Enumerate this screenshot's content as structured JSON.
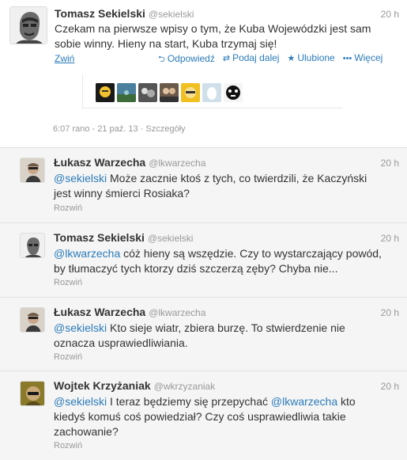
{
  "main_tweet": {
    "name": "Tomasz Sekielski",
    "handle": "@sekielski",
    "time": "20 h",
    "text_line1": "Czekam na pierwsze wpisy o tym, że Kuba Wojewódzki jest sam",
    "text_line2": "sobie winny. Hieny na start, Kuba trzymaj się!",
    "collapse_label": "Zwiń",
    "actions": {
      "reply": "Odpowiedź",
      "retweet": "Podaj dalej",
      "favorite": "Ulubione",
      "more": "Więcej"
    },
    "meta": "6:07 rano - 21 paź. 13 · Szczegóły"
  },
  "replies": [
    {
      "name": "Łukasz Warzecha",
      "handle": "@lkwarzecha",
      "time": "20 h",
      "mention": "@sekielski",
      "text_a": " Może zacznie ktoś z tych, co twierdzili, że Kaczyński",
      "text_b": "jest winny śmierci Rosiaka?",
      "expand": "Rozwiń"
    },
    {
      "name": "Tomasz Sekielski",
      "handle": "@sekielski",
      "time": "20 h",
      "mention": "@lkwarzecha",
      "text_a": " cóż hieny są wszędzie. Czy to wystarczający powód,",
      "text_b": "by tłumaczyć tych ktorzy dziś szczerzą zęby? Chyba nie...",
      "expand": "Rozwiń"
    },
    {
      "name": "Łukasz Warzecha",
      "handle": "@lkwarzecha",
      "time": "20 h",
      "mention": "@sekielski",
      "text_a": " Kto sieje wiatr, zbiera burzę. To stwierdzenie nie",
      "text_b": "oznacza usprawiedliwiania.",
      "expand": "Rozwiń"
    },
    {
      "name": "Wojtek Krzyżaniak",
      "handle": "@wkrzyzaniak",
      "time": "20 h",
      "mention": "@sekielski",
      "text_a": " I teraz będziemy się przepychać ",
      "mention2": "@lkwarzecha",
      "text_a2": " kto",
      "text_b": "kiedyś komuś coś powiedział? Czy coś usprawiedliwia takie",
      "text_c": "zachowanie?",
      "expand": "Rozwiń"
    }
  ],
  "colors": {
    "link": "#2b7bb9",
    "muted": "#999999",
    "reply_bg": "#f5f5f5"
  }
}
